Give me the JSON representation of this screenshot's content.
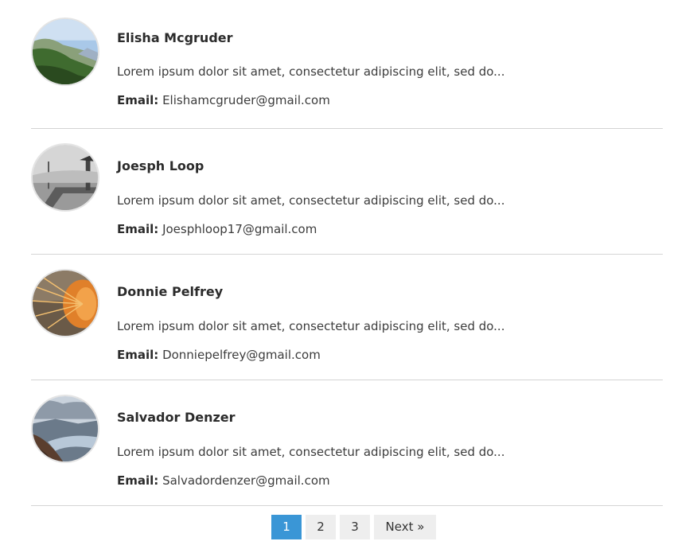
{
  "users": [
    {
      "name": "Elisha Mcgruder",
      "description": "Lorem ipsum dolor sit amet, consectetur adipiscing elit, sed do...",
      "email_label": "Email:",
      "email": "Elishamcgruder@gmail.com",
      "avatar": "mountain-landscape-photo"
    },
    {
      "name": "Joesph Loop",
      "description": "Lorem ipsum dolor sit amet, consectetur adipiscing elit, sed do...",
      "email_label": "Email:",
      "email": "Joesphloop17@gmail.com",
      "avatar": "pier-lighthouse-photo"
    },
    {
      "name": "Donnie Pelfrey",
      "description": "Lorem ipsum dolor sit amet, consectetur adipiscing elit, sed do...",
      "email_label": "Email:",
      "email": "Donniepelfrey@gmail.com",
      "avatar": "wheat-spike-photo"
    },
    {
      "name": "Salvador Denzer",
      "description": "Lorem ipsum dolor sit amet, consectetur adipiscing elit, sed do...",
      "email_label": "Email:",
      "email": "Salvadordenzer@gmail.com",
      "avatar": "fjord-valley-photo"
    }
  ],
  "pagination": {
    "pages": [
      "1",
      "2",
      "3"
    ],
    "active_page": "1",
    "next_label": "Next »"
  },
  "colors": {
    "active_page": "#3a96d6",
    "page_bg": "#eeeeee",
    "divider": "#d4d4d4"
  }
}
